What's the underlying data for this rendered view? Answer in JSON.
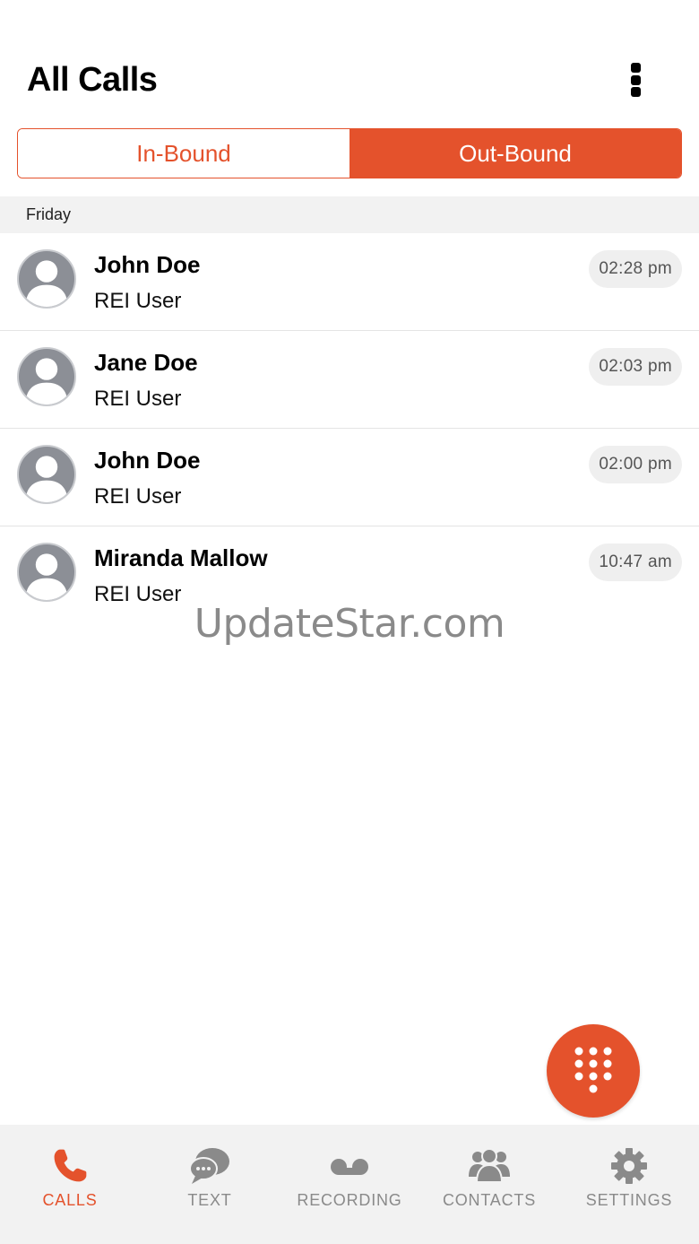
{
  "header": {
    "title": "All Calls",
    "menu_icon": "more-vertical-icon"
  },
  "segments": [
    {
      "label": "In-Bound",
      "selected": false
    },
    {
      "label": "Out-Bound",
      "selected": true
    }
  ],
  "section": {
    "label": "Friday"
  },
  "calls": [
    {
      "name": "John Doe",
      "subtitle": "REI User",
      "time": "02:28 pm"
    },
    {
      "name": "Jane Doe",
      "subtitle": "REI User",
      "time": "02:03 pm"
    },
    {
      "name": "John Doe",
      "subtitle": "REI User",
      "time": "02:00 pm"
    },
    {
      "name": "Miranda Mallow",
      "subtitle": "REI User",
      "time": "10:47 am"
    }
  ],
  "watermark": "UpdateStar.com",
  "fab": {
    "icon": "dialpad-icon"
  },
  "tabs": [
    {
      "label": "CALLS",
      "icon": "phone-icon",
      "active": true
    },
    {
      "label": "TEXT",
      "icon": "chat-bubbles-icon",
      "active": false
    },
    {
      "label": "RECORDING",
      "icon": "voicemail-icon",
      "active": false
    },
    {
      "label": "CONTACTS",
      "icon": "people-icon",
      "active": false
    },
    {
      "label": "SETTINGS",
      "icon": "gear-icon",
      "active": false
    }
  ],
  "colors": {
    "accent": "#e4522c",
    "inactive_tab": "#8a8a8a",
    "section_bg": "#f2f2f2"
  }
}
